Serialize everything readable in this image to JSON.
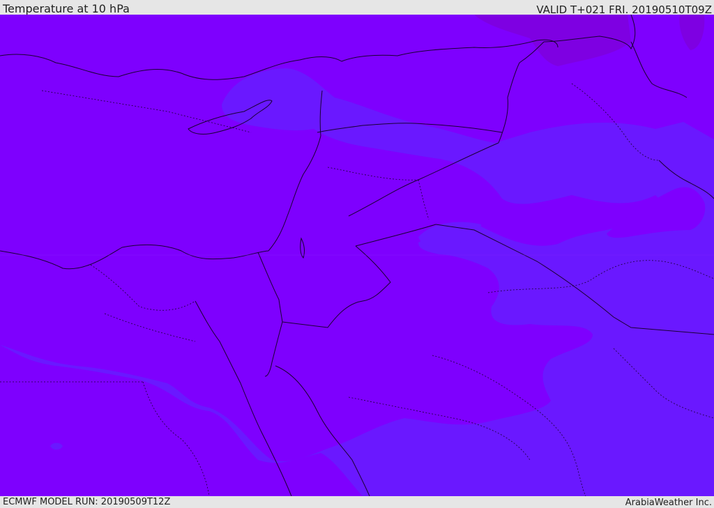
{
  "header": {
    "title": "Temperature at 10 hPa",
    "valid_time": "VALID T+021 FRI. 20190510T09Z"
  },
  "footer": {
    "model_run": "ECMWF MODEL RUN: 20190509T12Z",
    "credit": "ArabiaWeather Inc."
  },
  "map": {
    "fill_colors": {
      "warmer": "#7e00fe",
      "cooler": "#6a18ff",
      "warmest": "#7e00e2"
    },
    "line_color": "#1a0033"
  }
}
